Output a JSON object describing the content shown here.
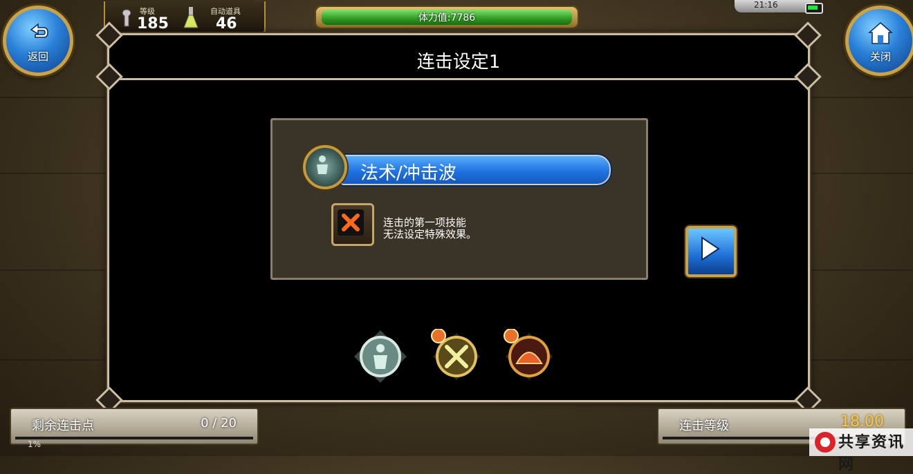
{
  "hud": {
    "level_label": "等级",
    "level_value": "185",
    "auto_items_label": "自动道具",
    "auto_items_value": "46",
    "stamina_text": "体力值:7786",
    "stamina_fill": 1.0,
    "clock": "21:16"
  },
  "nav": {
    "back_label": "返回",
    "close_label": "关闭"
  },
  "panel": {
    "title": "连击设定1",
    "skill_name": "法术/冲击波",
    "note_line1": "连击的第一项技能",
    "note_line2": "无法设定特殊效果。"
  },
  "skill_slots": [
    {
      "name": "skill-slot-1",
      "icon": "figure-emblem",
      "badge": ""
    },
    {
      "name": "skill-slot-2",
      "icon": "crossed-swords-emblem",
      "badge": "fist-badge"
    },
    {
      "name": "skill-slot-3",
      "icon": "fire-dome-emblem",
      "badge": "fist-badge"
    }
  ],
  "footer": {
    "remaining_label": "剩余连击点",
    "remaining_value": "0 / 20",
    "combo_level_label": "连击等级",
    "combo_level_value": "18.00",
    "percent_text": "1%"
  },
  "watermark": {
    "text": "共享资讯网"
  },
  "colors": {
    "accent_blue": "#1f72e0",
    "gold": "#c9a24a",
    "stamina_green": "#2f9a22",
    "level_gold": "#f5c84a"
  }
}
